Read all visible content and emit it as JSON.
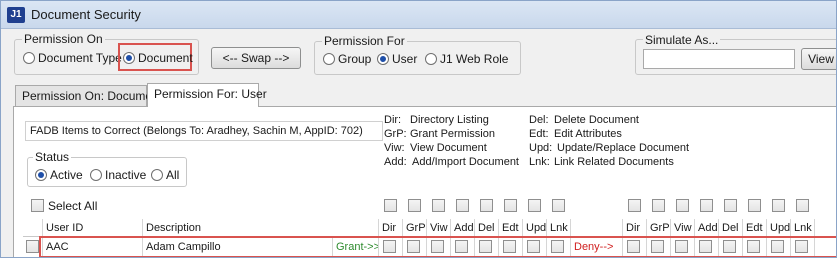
{
  "window": {
    "title": "Document Security",
    "icon": "J1"
  },
  "permission_on": {
    "legend": "Permission On",
    "options": [
      {
        "label": "Document Type",
        "checked": false
      },
      {
        "label": "Document",
        "checked": true
      }
    ]
  },
  "swap_button": "<-- Swap -->",
  "permission_for": {
    "legend": "Permission For",
    "options": [
      {
        "label": "Group",
        "checked": false
      },
      {
        "label": "User",
        "checked": true
      },
      {
        "label": "J1 Web Role",
        "checked": false
      }
    ]
  },
  "simulate": {
    "legend": "Simulate As...",
    "value": "",
    "view_button": "View"
  },
  "tabs": [
    {
      "label": "Permission On: Document",
      "active": false
    },
    {
      "label": "Permission For: User",
      "active": true
    }
  ],
  "info_box": "FADB Items to Correct (Belongs To: Aradhey, Sachin M, AppID: 702)",
  "status": {
    "legend": "Status",
    "options": [
      {
        "label": "Active",
        "checked": true
      },
      {
        "label": "Inactive",
        "checked": false
      },
      {
        "label": "All",
        "checked": false
      }
    ]
  },
  "abbreviations_left": [
    {
      "code": "Dir:",
      "text": "Directory Listing"
    },
    {
      "code": "GrP:",
      "text": "Grant Permission"
    },
    {
      "code": "Viw:",
      "text": "View Document"
    },
    {
      "code": "Add:",
      "text": "Add/Import Document"
    }
  ],
  "abbreviations_right": [
    {
      "code": "Del:",
      "text": "Delete Document"
    },
    {
      "code": "Edt:",
      "text": "Edit Attributes"
    },
    {
      "code": "Upd:",
      "text": "Update/Replace Document"
    },
    {
      "code": "Lnk:",
      "text": "Link Related Documents"
    }
  ],
  "select_all": "Select All",
  "grid": {
    "headers": {
      "user_id": "User ID",
      "description": "Description",
      "grant_perms": [
        "Dir",
        "GrP",
        "Viw",
        "Add",
        "Del",
        "Edt",
        "Upd",
        "Lnk"
      ],
      "deny_perms": [
        "Dir",
        "GrP",
        "Viw",
        "Add",
        "Del",
        "Edt",
        "Upd",
        "Lnk"
      ]
    },
    "rows": [
      {
        "user_id": "AAC",
        "description": "Adam Campillo",
        "grant_label": "Grant->>",
        "deny_label": "Deny-->"
      }
    ]
  },
  "colors": {
    "highlight_border": "#d9534f",
    "grant": "#2e8b2e",
    "deny": "#d02020",
    "radio_dot": "#1f4fa8"
  }
}
